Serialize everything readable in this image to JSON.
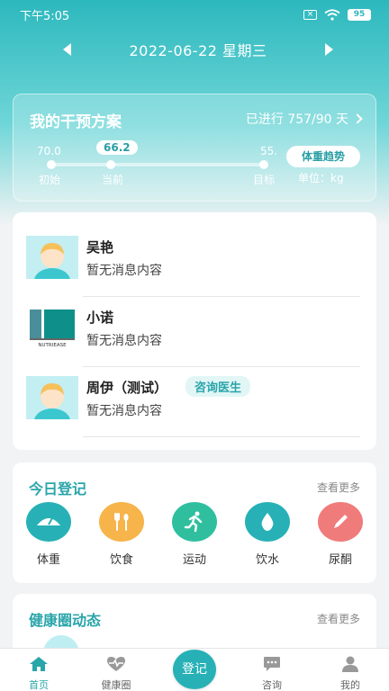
{
  "status_bar": {
    "time": "下午5:05",
    "battery": "95"
  },
  "date_nav": {
    "date": "2022-06-22 星期三"
  },
  "plan": {
    "title": "我的干预方案",
    "progress": "已进行 757/90 天",
    "start_value": "70.0",
    "current_value": "66.2",
    "target_value": "55.",
    "start_label": "初始",
    "current_label": "当前",
    "target_label": "目标",
    "trend_button": "体重趋势",
    "unit": "单位：kg",
    "progress_fraction": 0.28
  },
  "messages": [
    {
      "name": "吴艳",
      "text": "暂无消息内容",
      "avatar": "person-avatar"
    },
    {
      "name": "小诺",
      "text": "暂无消息内容",
      "avatar": "nutriease-logo",
      "logo_text": "NUTRIEASE"
    },
    {
      "name": "周伊（测试）",
      "text": "暂无消息内容",
      "avatar": "person-avatar",
      "tag": "咨询医生"
    }
  ],
  "today": {
    "title": "今日登记",
    "more": "查看更多",
    "items": [
      {
        "label": "体重",
        "icon": "scale-icon",
        "color": "#27b1b6"
      },
      {
        "label": "饮食",
        "icon": "cutlery-icon",
        "color": "#f6b44a"
      },
      {
        "label": "运动",
        "icon": "running-icon",
        "color": "#2fbf9f"
      },
      {
        "label": "饮水",
        "icon": "water-drop-icon",
        "color": "#27b1b6"
      },
      {
        "label": "尿酮",
        "icon": "pencil-icon",
        "color": "#f07b7b"
      }
    ]
  },
  "health": {
    "title": "健康圈动态",
    "more": "查看更多"
  },
  "bottom_nav": {
    "items": [
      {
        "label": "首页",
        "icon": "home-icon",
        "active": true
      },
      {
        "label": "健康圈",
        "icon": "heart-pulse-icon",
        "active": false
      },
      {
        "label": "咨询",
        "icon": "chat-icon",
        "active": false
      },
      {
        "label": "我的",
        "icon": "user-icon",
        "active": false
      }
    ],
    "center_button": "登记"
  },
  "colors": {
    "accent": "#2aa5aa",
    "header_top": "#2cb8bd"
  }
}
